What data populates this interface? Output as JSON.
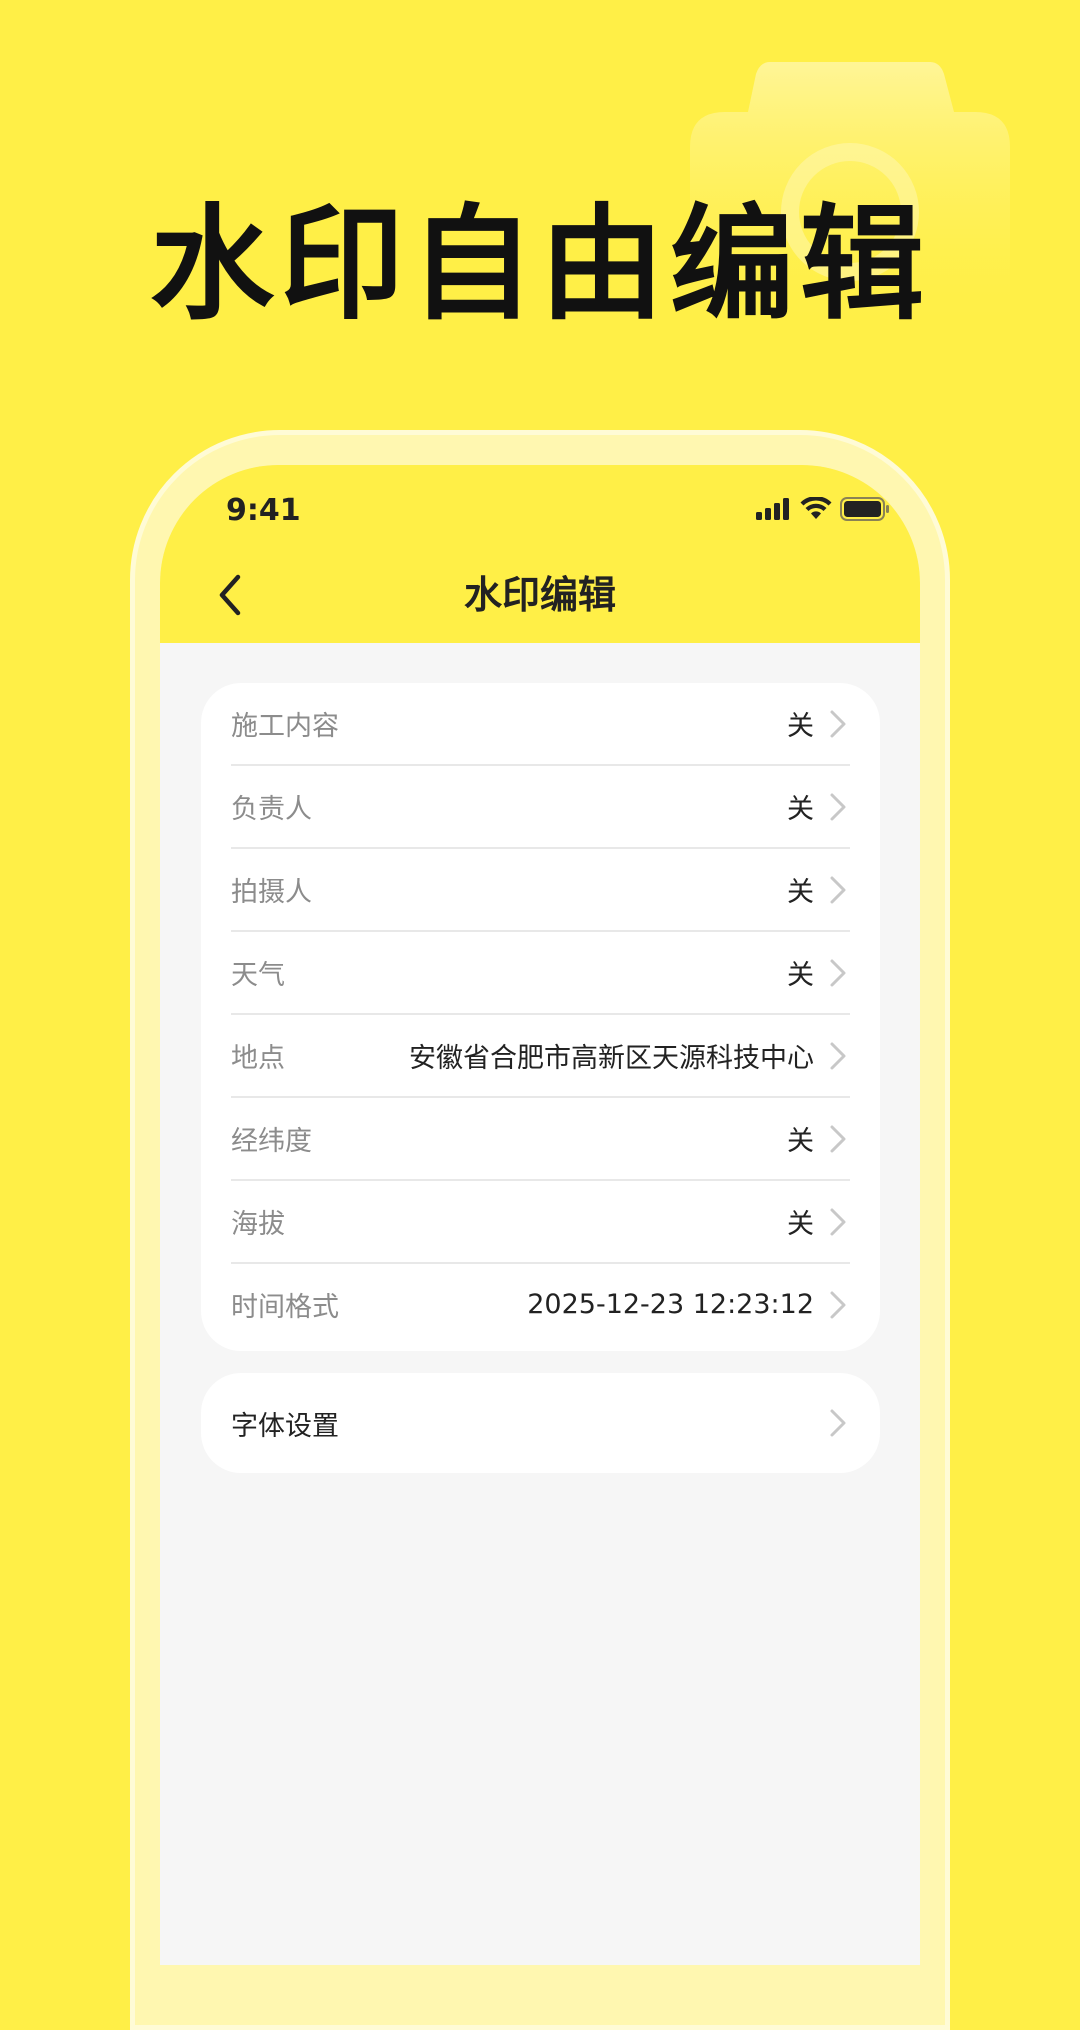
{
  "hero": {
    "headline": "水印自由编辑"
  },
  "status_bar": {
    "time": "9:41",
    "icons": [
      "signal-icon",
      "wifi-icon",
      "battery-icon"
    ]
  },
  "nav": {
    "back_icon": "chevron-left-icon",
    "title": "水印编辑"
  },
  "settings": {
    "items": [
      {
        "label": "施工内容",
        "value": "关"
      },
      {
        "label": "负责人",
        "value": "关"
      },
      {
        "label": "拍摄人",
        "value": "关"
      },
      {
        "label": "天气",
        "value": "关"
      },
      {
        "label": "地点",
        "value": "安徽省合肥市高新区天源科技中心"
      },
      {
        "label": "经纬度",
        "value": "关"
      },
      {
        "label": "海拔",
        "value": "关"
      },
      {
        "label": "时间格式",
        "value": "2025-12-23 12:23:12"
      }
    ]
  },
  "font_settings": {
    "label": "字体设置"
  },
  "colors": {
    "background": "#FFEF47",
    "phone_frame": "#FFF7B0",
    "screen": "#F6F6F6",
    "card": "#FFFFFF",
    "label_gray": "#8C8C8C",
    "text_dark": "#222222"
  }
}
